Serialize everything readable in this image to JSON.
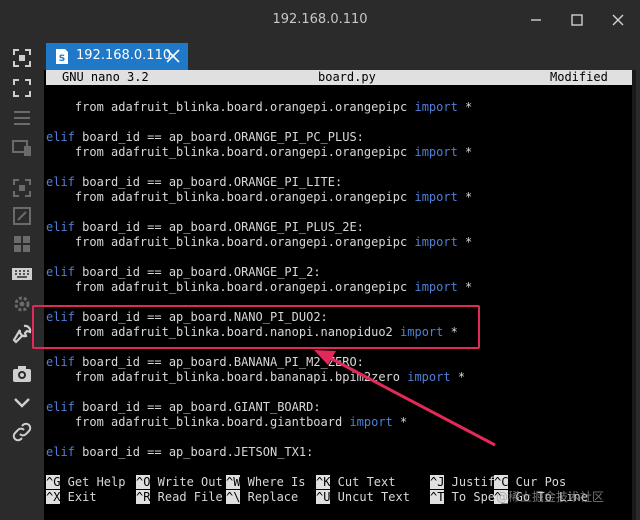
{
  "window": {
    "title": "192.168.0.110",
    "minimize_icon": "minimize-icon",
    "maximize_icon": "maximize-icon",
    "close_icon": "close-icon"
  },
  "tab": {
    "label": "192.168.0.110",
    "icon": "terminal-session-icon",
    "close_icon": "close-icon",
    "accent_color": "#1f78c8"
  },
  "sidebar": {
    "icons": [
      "fullscreen-icon",
      "fit-screen-icon",
      "menu-icon",
      "devices-icon",
      "select-icon",
      "resize-icon",
      "dashboard-icon",
      "keyboard-icon",
      "settings-icon",
      "wrench-icon",
      "camera-icon",
      "chevron-down-icon",
      "link-icon"
    ]
  },
  "nano": {
    "version": "GNU nano 3.2",
    "filename": "board.py",
    "state": "Modified",
    "lines": [
      {
        "kw": "",
        "rest": "    from adafruit_blinka.board.orangepi.orangepipc ",
        "kw2": "import",
        "tail": " *"
      },
      {
        "kw": "elif",
        "rest": " board_id == ap_board.ORANGE_PI_PC_PLUS:",
        "kw2": "",
        "tail": ""
      },
      {
        "kw": "",
        "rest": "    from adafruit_blinka.board.orangepi.orangepipc ",
        "kw2": "import",
        "tail": " *"
      },
      {
        "kw": "elif",
        "rest": " board_id == ap_board.ORANGE_PI_LITE:",
        "kw2": "",
        "tail": ""
      },
      {
        "kw": "",
        "rest": "    from adafruit_blinka.board.orangepi.orangepipc ",
        "kw2": "import",
        "tail": " *"
      },
      {
        "kw": "elif",
        "rest": " board_id == ap_board.ORANGE_PI_PLUS_2E:",
        "kw2": "",
        "tail": ""
      },
      {
        "kw": "",
        "rest": "    from adafruit_blinka.board.orangepi.orangepipc ",
        "kw2": "import",
        "tail": " *"
      },
      {
        "kw": "elif",
        "rest": " board_id == ap_board.ORANGE_PI_2:",
        "kw2": "",
        "tail": ""
      },
      {
        "kw": "",
        "rest": "    from adafruit_blinka.board.orangepi.orangepipc ",
        "kw2": "import",
        "tail": " *"
      },
      {
        "kw": "elif",
        "rest": " board_id == ap_board.NANO_PI_DUO2:",
        "kw2": "",
        "tail": ""
      },
      {
        "kw": "",
        "rest": "    from adafruit_blinka.board.nanopi.nanopiduo2 ",
        "kw2": "import",
        "tail": " *"
      },
      {
        "kw": "elif",
        "rest": " board_id == ap_board.BANANA_PI_M2_ZERO:",
        "kw2": "",
        "tail": ""
      },
      {
        "kw": "",
        "rest": "    from adafruit_blinka.board.bananapi.bpim2zero ",
        "kw2": "import",
        "tail": " *"
      },
      {
        "kw": "elif",
        "rest": " board_id == ap_board.GIANT_BOARD:",
        "kw2": "",
        "tail": ""
      },
      {
        "kw": "",
        "rest": "    from adafruit_blinka.board.giantboard ",
        "kw2": "import",
        "tail": " *"
      },
      {
        "kw": "elif",
        "rest": " board_id == ap_board.JETSON_TX1:",
        "kw2": "",
        "tail": ""
      }
    ],
    "shortcuts_row1": [
      {
        "key": "^G",
        "label": " Get Help"
      },
      {
        "key": "^O",
        "label": " Write Out"
      },
      {
        "key": "^W",
        "label": " Where Is"
      },
      {
        "key": "^K",
        "label": " Cut Text"
      },
      {
        "key": "^J",
        "label": " Justify"
      },
      {
        "key": "^C",
        "label": " Cur Pos"
      }
    ],
    "shortcuts_row2": [
      {
        "key": "^X",
        "label": " Exit"
      },
      {
        "key": "^R",
        "label": " Read File"
      },
      {
        "key": "^\\",
        "label": " Replace"
      },
      {
        "key": "^U",
        "label": " Uncut Text"
      },
      {
        "key": "^T",
        "label": " To Spell"
      },
      {
        "key": "^_",
        "label": " Go To Line"
      }
    ]
  },
  "watermark": "@稀土掘金技术社区",
  "annotation_color": "#e2295a"
}
